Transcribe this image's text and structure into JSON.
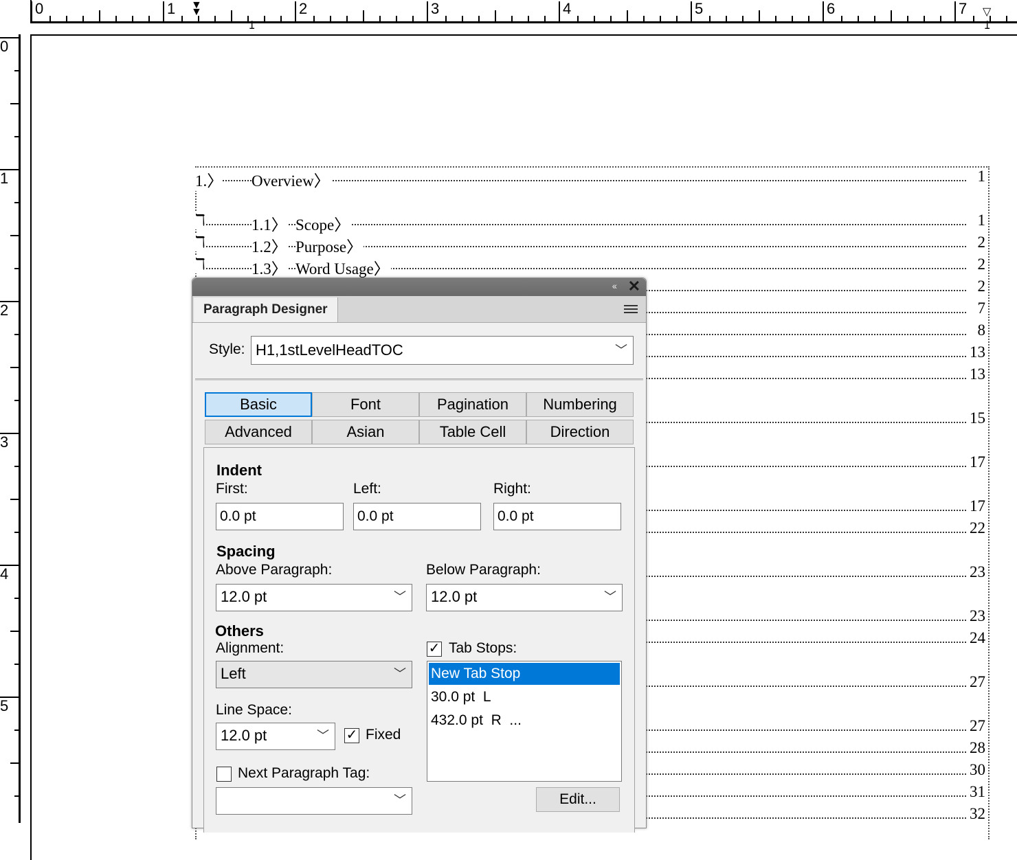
{
  "ruler": {
    "horizontal_numbers": [
      "0",
      "1",
      "2",
      "3",
      "4",
      "5",
      "6",
      "7"
    ],
    "vertical_numbers": [
      "0",
      "1",
      "2",
      "3",
      "4",
      "5"
    ]
  },
  "toc": {
    "entries": [
      {
        "num": "1.〉",
        "title": "Overview〉",
        "page": "1"
      },
      {
        "num": "1.1〉",
        "title": "Scope〉",
        "page": "1"
      },
      {
        "num": "1.2〉",
        "title": "Purpose〉",
        "page": "2"
      },
      {
        "num": "1.3〉",
        "title": "Word Usage〉",
        "page": "2"
      }
    ],
    "hidden_page_numbers": [
      "2",
      "7",
      "8",
      "13",
      "13",
      "15",
      "17",
      "17",
      "22",
      "23",
      "23",
      "24",
      "27",
      "27",
      "28",
      "30",
      "31",
      "32"
    ],
    "marker_glyph": "ℸ"
  },
  "dialog": {
    "panel_tab": "Paragraph Designer",
    "collapse_glyph": "‹‹",
    "close_glyph": "✕",
    "style_label": "Style:",
    "style_value": "H1,1stLevelHeadTOC",
    "tabs": [
      "Basic",
      "Font",
      "Pagination",
      "Numbering",
      "Advanced",
      "Asian",
      "Table Cell",
      "Direction"
    ],
    "active_tab": "Basic",
    "indent": {
      "header": "Indent",
      "first_label": "First:",
      "first_value": "0.0 pt",
      "left_label": "Left:",
      "left_value": "0.0 pt",
      "right_label": "Right:",
      "right_value": "0.0 pt"
    },
    "spacing": {
      "header": "Spacing",
      "above_label": "Above Paragraph:",
      "above_value": "12.0 pt",
      "below_label": "Below Paragraph:",
      "below_value": "12.0 pt"
    },
    "others": {
      "header": "Others",
      "alignment_label": "Alignment:",
      "alignment_value": "Left",
      "line_space_label": "Line Space:",
      "line_space_value": "12.0 pt",
      "fixed_label": "Fixed",
      "fixed_checked": true,
      "next_tag_label": "Next Paragraph Tag:",
      "next_tag_checked": false,
      "next_tag_value": "",
      "tab_stops_label": "Tab Stops:",
      "tab_stops_checked": true,
      "tab_stops": [
        "New Tab Stop",
        "30.0 pt  L",
        "432.0 pt  R  ..."
      ],
      "edit_label": "Edit..."
    }
  },
  "colors": {
    "selection": "#0078d7",
    "active_tab": "#cce4f7",
    "titlebar": "#727272"
  }
}
